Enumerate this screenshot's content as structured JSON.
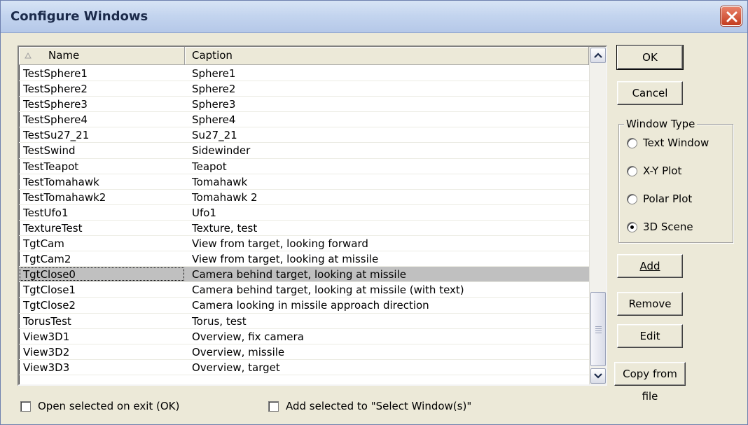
{
  "window": {
    "title": "Configure Windows"
  },
  "list": {
    "columns": [
      "Name",
      "Caption"
    ],
    "rows": [
      {
        "name": "TestSphere1",
        "caption": "Sphere1"
      },
      {
        "name": "TestSphere2",
        "caption": "Sphere2"
      },
      {
        "name": "TestSphere3",
        "caption": "Sphere3"
      },
      {
        "name": "TestSphere4",
        "caption": "Sphere4"
      },
      {
        "name": "TestSu27_21",
        "caption": "Su27_21"
      },
      {
        "name": "TestSwind",
        "caption": "Sidewinder"
      },
      {
        "name": "TestTeapot",
        "caption": "Teapot"
      },
      {
        "name": "TestTomahawk",
        "caption": "Tomahawk"
      },
      {
        "name": "TestTomahawk2",
        "caption": "Tomahawk 2"
      },
      {
        "name": "TestUfo1",
        "caption": "Ufo1"
      },
      {
        "name": "TextureTest",
        "caption": "Texture, test"
      },
      {
        "name": "TgtCam",
        "caption": "View from target, looking forward"
      },
      {
        "name": "TgtCam2",
        "caption": "View from target, looking at missile"
      },
      {
        "name": "TgtClose0",
        "caption": "Camera behind target, looking at missile"
      },
      {
        "name": "TgtClose1",
        "caption": "Camera behind target, looking at missile (with text)"
      },
      {
        "name": "TgtClose2",
        "caption": "Camera looking in missile approach direction"
      },
      {
        "name": "TorusTest",
        "caption": "Torus, test"
      },
      {
        "name": "View3D1",
        "caption": "Overview, fix camera"
      },
      {
        "name": "View3D2",
        "caption": "Overview, missile"
      },
      {
        "name": "View3D3",
        "caption": "Overview, target"
      }
    ],
    "selected_row": "TgtClose0"
  },
  "buttons": {
    "ok": "OK",
    "cancel": "Cancel",
    "add": "Add",
    "remove": "Remove",
    "edit": "Edit",
    "copy_from_file": "Copy from file"
  },
  "window_type": {
    "legend": "Window Type",
    "options": [
      "Text Window",
      "X-Y Plot",
      "Polar Plot",
      "3D Scene"
    ],
    "selected": "3D Scene"
  },
  "checkboxes": {
    "open_selected": {
      "label": "Open selected on exit (OK)",
      "checked": false
    },
    "add_selected": {
      "label": "Add selected to \"Select Window(s)\"",
      "checked": false
    }
  },
  "colors": {
    "dialog_bg": "#ece9d8",
    "selection_bg": "#c0c0c0",
    "close_button": "#c43c1e"
  },
  "icons": [
    "close-icon",
    "sort-ascending-icon",
    "scroll-up-icon",
    "scroll-down-icon"
  ]
}
